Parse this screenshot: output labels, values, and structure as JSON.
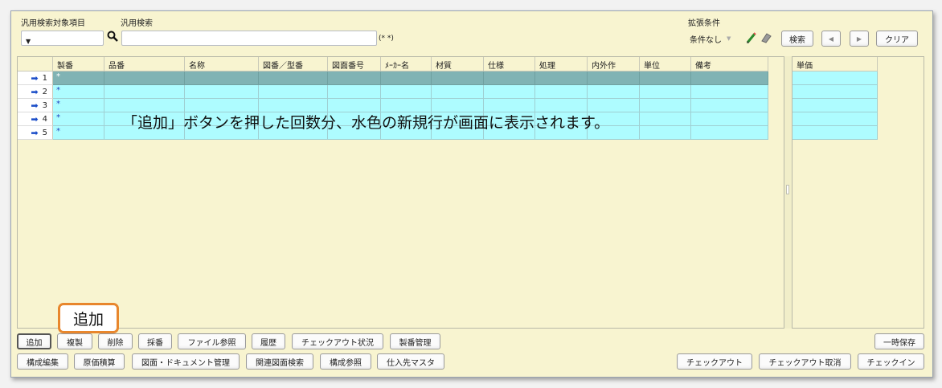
{
  "search": {
    "target_label": "汎用検索対象項目",
    "search_label": "汎用検索",
    "hint": "(* *)",
    "ext_label": "拡張条件",
    "ext_value": "条件なし",
    "search_button": "検索",
    "prev_button": "◀",
    "next_button": "▶",
    "clear_button": "クリア"
  },
  "grid": {
    "columns": [
      "製番",
      "品番",
      "名称",
      "図番／型番",
      "図面番号",
      "ﾒｰｶｰ名",
      "材質",
      "仕様",
      "処理",
      "内外作",
      "単位",
      "備考"
    ],
    "rows": [
      {
        "num": "1",
        "mark": "*"
      },
      {
        "num": "2",
        "mark": "*"
      },
      {
        "num": "3",
        "mark": "*"
      },
      {
        "num": "4",
        "mark": "*"
      },
      {
        "num": "5",
        "mark": "*"
      }
    ],
    "right_columns": [
      "単価"
    ]
  },
  "annotation": "「追加」ボタンを押した回数分、水色の新規行が画面に表示されます。",
  "callout": "追加",
  "toolbar1": [
    "追加",
    "複製",
    "削除",
    "採番",
    "ファイル参照",
    "履歴",
    "チェックアウト状況",
    "製番管理"
  ],
  "toolbar1_right": "一時保存",
  "toolbar2": [
    "構成編集",
    "原価積算",
    "図面・ドキュメント管理",
    "関連図面検索",
    "構成参照",
    "仕入先マスタ"
  ],
  "toolbar2_right": [
    "チェックアウト",
    "チェックアウト取消",
    "チェックイン"
  ],
  "colors": {
    "accent": "#e8862c",
    "new_row": "#aefcff",
    "selected_row": "#80b3b4"
  }
}
